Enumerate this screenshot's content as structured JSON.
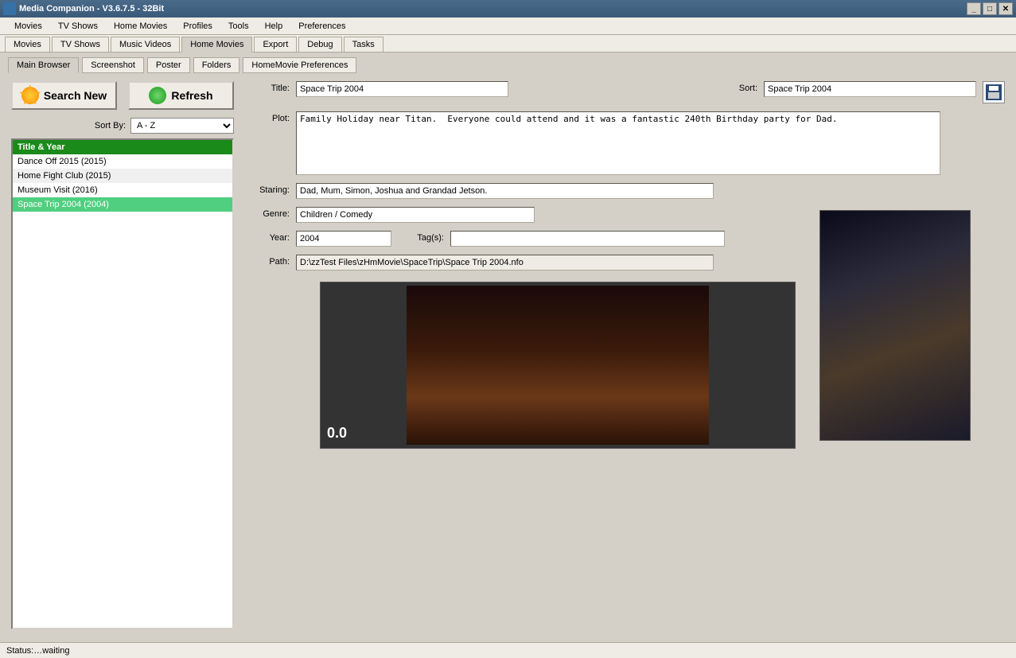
{
  "window": {
    "title": "Media Companion - V3.6.7.5 - 32Bit"
  },
  "menubar": {
    "items": [
      "Movies",
      "TV Shows",
      "Home Movies",
      "Profiles",
      "Tools",
      "Help",
      "Preferences"
    ]
  },
  "tabs": {
    "items": [
      "Movies",
      "TV Shows",
      "Music Videos",
      "Home Movies",
      "Export",
      "Debug",
      "Tasks"
    ],
    "active": 3
  },
  "subtabs": {
    "items": [
      "Main Browser",
      "Screenshot",
      "Poster",
      "Folders",
      "HomeMovie Preferences"
    ],
    "active": 0
  },
  "buttons": {
    "search_new": "Search New",
    "refresh": "Refresh"
  },
  "sortby": {
    "label": "Sort By:",
    "value": "A - Z"
  },
  "list": {
    "header": "Title & Year",
    "items": [
      "Dance Off 2015 (2015)",
      "Home Fight Club (2015)",
      "Museum Visit (2016)",
      "Space Trip 2004 (2004)"
    ],
    "selected": 3
  },
  "form": {
    "title_label": "Title:",
    "title": "Space Trip 2004",
    "sort_label": "Sort:",
    "sort": "Space Trip 2004",
    "plot_label": "Plot:",
    "plot": "Family Holiday near Titan.  Everyone could attend and it was a fantastic 240th Birthday party for Dad.",
    "staring_label": "Staring:",
    "staring": "Dad, Mum, Simon, Joshua and Grandad Jetson.",
    "genre_label": "Genre:",
    "genre": "Children / Comedy",
    "year_label": "Year:",
    "year": "2004",
    "tags_label": "Tag(s):",
    "tags": "",
    "path_label": "Path:",
    "path": "D:\\zzTest Files\\zHmMovie\\SpaceTrip\\Space Trip 2004.nfo"
  },
  "fanart_overlay": "0.0",
  "status": "Status:…waiting"
}
